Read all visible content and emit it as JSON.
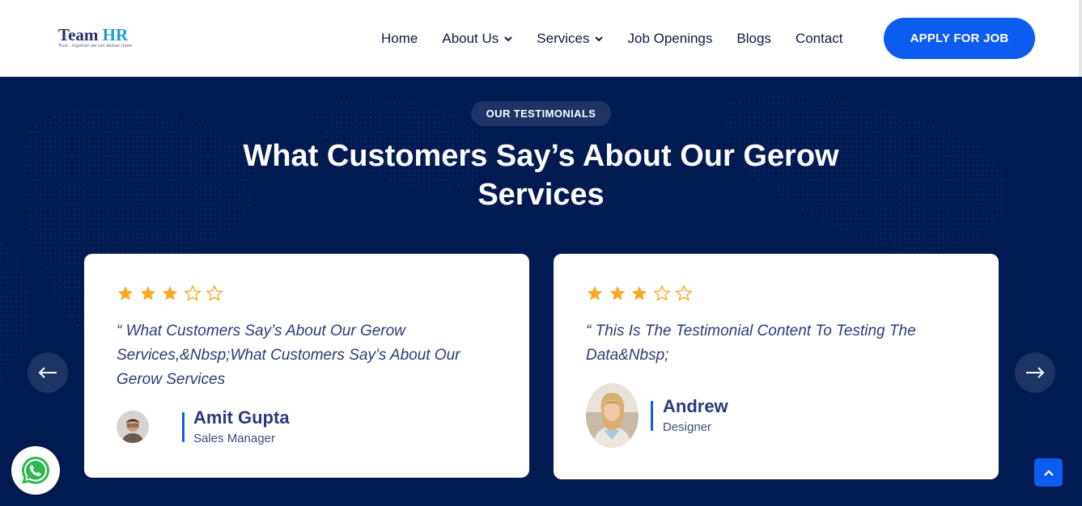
{
  "header": {
    "logo": {
      "brand_a": "Team ",
      "brand_b": "HR",
      "tagline": "Trust , together we can deliver more"
    },
    "nav": [
      {
        "label": "Home"
      },
      {
        "label": "About Us"
      },
      {
        "label": "Services"
      },
      {
        "label": "Job Openings"
      },
      {
        "label": "Blogs"
      },
      {
        "label": "Contact"
      }
    ],
    "apply_label": "APPLY FOR JOB"
  },
  "testimonials": {
    "badge": "OUR TESTIMONIALS",
    "title": "What Customers Say’s About Our Gerow Services",
    "cards": [
      {
        "rating": 3,
        "max_rating": 5,
        "quote": "“ What Customers Say’s About Our Gerow Services,&Nbsp;What Customers Say’s About Our Gerow Services",
        "name": "Amit Gupta",
        "role": "Sales Manager"
      },
      {
        "rating": 3,
        "max_rating": 5,
        "quote": "“ This Is The Testimonial Content To Testing The Data&Nbsp;",
        "name": "Andrew",
        "role": "Designer"
      }
    ]
  },
  "colors": {
    "accent": "#0d5cf0",
    "section_bg": "#011a52",
    "star": "#f9a825",
    "text_dark": "#2d3a78"
  },
  "icons": {
    "prev": "arrow-left-icon",
    "next": "arrow-right-icon",
    "whatsapp": "whatsapp-icon",
    "scroll_top": "chevron-up-icon"
  }
}
